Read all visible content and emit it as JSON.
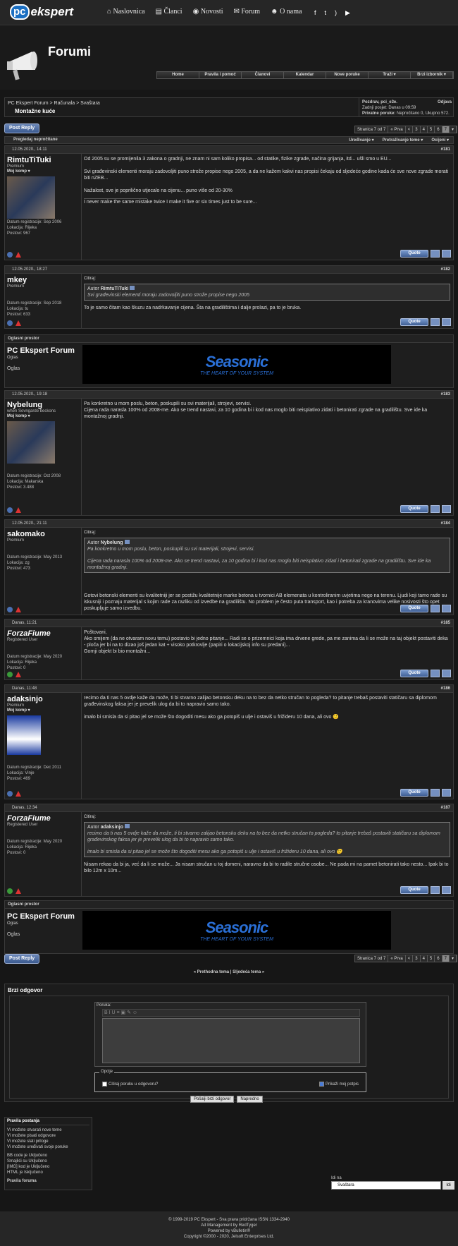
{
  "topnav": {
    "logo_pc": "pc",
    "logo_rest": "ekspert",
    "items": [
      "Naslovnica",
      "Članci",
      "Novosti",
      "Forum",
      "O nama"
    ]
  },
  "header": {
    "title": "Forumi",
    "nav": [
      "Home",
      "Pravila i pomoć",
      "Članovi",
      "Kalendar",
      "Nove poruke",
      "Traži ▾",
      "Brzi izbornik ▾"
    ]
  },
  "breadcrumb": {
    "path": "PC Ekspert Forum > Računala > Svaštara",
    "thread": "Montažne kuće",
    "greet": "Pozdrav, pci_e3e.",
    "logout": "Odjava",
    "last": "Zadnji posjet: Danas u 09:59",
    "pm_label": "Privatne poruke:",
    "pm": "Nepročitano 0, Ukupno 572."
  },
  "reply_label": "Post Reply",
  "pager": {
    "label": "Stranica 7 od 7",
    "first": "« Prva",
    "prev": "<",
    "pages": [
      "3",
      "4",
      "5",
      "6",
      "7"
    ],
    "current": "7",
    "menu": "▾"
  },
  "tools": {
    "unread": "Pregledaj nepročitane",
    "edit": "Uređivanje ▾",
    "search": "Pretraživanje teme ▾",
    "rate": "Ocijeni ▾"
  },
  "quote_label": "Quote",
  "quote_cited": "Citiraj:",
  "quote_author": "Autor",
  "posts": [
    {
      "date": "12.05.2020., 14:11",
      "num": "#181",
      "user": "RimtuTiTuki",
      "rank": "Premium",
      "moj": "Moj komp ▾",
      "reg": "Datum registracije: Sep 2006",
      "loc": "Lokacija: Rijeka",
      "posts": "Postovi: 967",
      "lines": [
        "Od 2005 su se promijenila 3 zakona o gradnji, ne znam ni sam koliko propisa... od statike, fizike zgrade, načina grijanja, itd... ušli smo u EU...",
        "Svi građevinski elementi moraju zadovoljiti puno strože propise nego 2005, a da ne kažem kakvi nas propisi čekaju od sljedeće godine kada će sve nove zgrade morati biti nZEB...",
        "Nažalost, sve je poprilično utjecalo na cijenu... puno više od 20-30%"
      ],
      "sig": "I never make the same mistake twice I make it five or six times just to be sure..."
    },
    {
      "date": "12.05.2020., 18:27",
      "num": "#182",
      "user": "mkey",
      "rank": "Premium",
      "reg": "Datum registracije: Sep 2018",
      "loc": "Lokacija: tu",
      "posts": "Postovi: 633",
      "qauthor": "RimtuTiTuki",
      "qtext": [
        "Svi građevinski elementi moraju zadovoljiti puno strože propise nego 2005"
      ],
      "lines": [
        "To je samo čitam kao škuzu za nadrkavanje cijena. Šta na gradilištima i dalje prolazi, pa to je bruka."
      ]
    },
    {
      "date": "12.05.2020., 19:18",
      "num": "#183",
      "user": "Nybelung",
      "rank": "when Sovngarde beckons",
      "moj": "Moj komp ▾",
      "reg": "Datum registracije: Oct 2008",
      "loc": "Lokacija: Makarska",
      "posts": "Postovi: 3.488",
      "lines": [
        "Pa konkretno u mom poslu, beton, poskupili su svi materijali, strojevi, servisi.",
        "Cijena rada narasla 100% od 2008-me. Ako se trend nastavi, za 10 godina bi i kod nas moglo biti neisplativo zidati i betonirati zgrade na gradilištu. Sve ide ka montažnoj gradnji."
      ]
    },
    {
      "date": "12.05.2020., 21:11",
      "num": "#184",
      "user": "sakomako",
      "rank": "Premium",
      "reg": "Datum registracije: May 2013",
      "loc": "Lokacija: zg",
      "posts": "Postovi: 473",
      "qauthor": "Nybelung",
      "qtext": [
        "Pa konkretno u mom poslu, beton, poskupili su svi materijali, strojevi, servisi.",
        "Cijena rada narasla 100% od 2008-me. Ako se trend nastavi, za 10 godina bi i kod nas moglo biti neisplativo zidati i betonirati zgrade na gradilištu. Sve ide ka montažnoj gradnji."
      ],
      "lines": [
        "Gotovi betonski elementi su kvalitetniji jer se postižu kvalitetnije marke betona u tvornici AB elemenata u kontroliranim uvjetima nego na terenu. Ljudi koji tamo rade su iskusniji i poznaju materijal s kojim rade za razliku od izvedbe na gradilištu. No problem je često puta transport, kao i potreba za kranovima velike nosivosti što opet poskupljuje samo izvedbu."
      ]
    },
    {
      "date": "Danas, 11:21",
      "num": "#185",
      "user": "ForzaFiume",
      "rank": "Registered User",
      "reg": "Datum registracije: May 2020",
      "loc": "Lokacija: Rijeka",
      "posts": "Postovi: 0",
      "lines": [
        "Poštovani,",
        "Ako smijem (da ne otvaram novu temu) postavio bi jedno pitanje... Radi se o prizemnici koja ima drvene grede, pa me zanima da li se može na taj objekt postaviti deka - ploča jer bi na to dizao još jedan kat + visoko potkrovlje (papiri o lokacijskoj info su predani)...",
        "Gornji objekt bi bio montažni..."
      ]
    },
    {
      "date": "Danas, 11:48",
      "num": "#186",
      "user": "adaksinjo",
      "rank": "Premium",
      "moj": "Moj komp ▾",
      "reg": "Datum registracije: Dec 2011",
      "loc": "Lokacija: Vinje",
      "posts": "Postovi: 469",
      "lines": [
        "recimo da ti nas 5 ovdje kaže da može, ti bi stvarno zalijao betonsku deku na to bez da netko stručan to pogleda? to pitanje trebaš postaviti statičaru sa diplomom građevinskog faksa jer je prevelik ulog da bi to napravio samo tako.",
        "imalo bi smisla da si pitao jel se može što dogoditi mesu ako ga potopiš u ulje i ostaviš u frižideru 10 dana, ali ovo 🙂"
      ]
    },
    {
      "date": "Danas, 12:34",
      "num": "#187",
      "user": "ForzaFiume",
      "rank": "Registered User",
      "reg": "Datum registracije: May 2020",
      "loc": "Lokacija: Rijeka",
      "posts": "Postovi: 0",
      "qauthor": "adaksinjo",
      "qtext": [
        "recimo da ti nas 5 ovdje kaže da može, ti bi stvarno zalijao betonsku deku na to bez da netko stručan to pogleda? to pitanje trebaš postaviti statičaru sa diplomom građevinskog faksa jer je prevelik ulog da bi to napravio samo tako.",
        "imalo bi smisla da si pitao jel se može što dogoditi mesu ako ga potopiš u ulje i ostaviš u frižideru 10 dana, ali ovo 🙂"
      ],
      "lines": [
        "Nisam rekao da bi ja, već da li se može... Ja nisam stručan u toj domeni, naravno da bi to radile stručne osobe... Ne pada mi na pamet betonirati tako nesto... Ipak bi to bilo 12m x 10m..."
      ]
    }
  ],
  "ad": {
    "header": "Oglasni prostor",
    "name": "PC Ekspert Forum",
    "sub": "Oglas",
    "sub2": "Oglas",
    "brand": "Seasonic",
    "tagline": "THE HEART OF YOUR SYSTEM"
  },
  "navlinks": "« Prethodna tema | Sljedeća tema »",
  "quickreply": {
    "title": "Brzi odgovor",
    "label": "Poruka:",
    "options": "Opcije",
    "quote_opt": "Citiraj poruku u odgovoru?",
    "sig_opt": "Prikaži moj potpis",
    "send": "Pošalji brzi odgovor",
    "advanced": "Napredno"
  },
  "rules": {
    "title": "Pravila postanja",
    "lines": [
      "Vi možete otvarati nove teme",
      "Vi možete pisati odgovore",
      "Vi možete slati priloge",
      "Vi možete uređivati svoje poruke"
    ],
    "codes": [
      "BB code je Uključeno",
      "Smajlići su Uključeno",
      "[IMG] kod je Uključeno",
      "HTML je Isključeno"
    ],
    "forum": "Pravila foruma"
  },
  "jump": {
    "label": "Idi na",
    "value": "Svaštara",
    "go": "Idi"
  },
  "footer": [
    "© 1999-2019 PC Ekspert - Sva prava pridržana ISSN 1334-2940",
    "Ad Management by RedTyger",
    "Powered by vBulletin®",
    "Copyright ©2000 - 2020, Jelsoft Enterprises Ltd."
  ]
}
